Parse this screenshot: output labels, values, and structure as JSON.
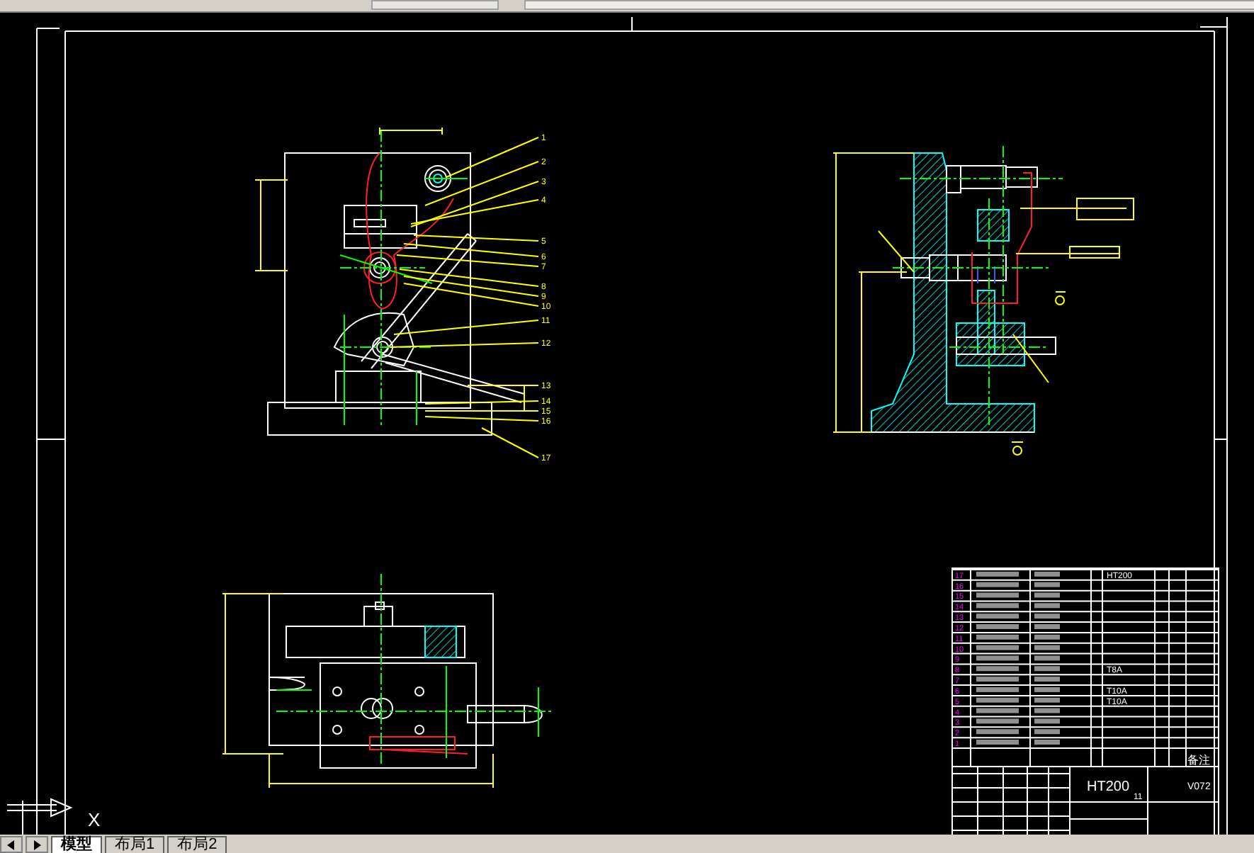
{
  "drawing": {
    "front_view_callouts": [
      "1",
      "2",
      "3",
      "4",
      "5",
      "6",
      "7",
      "8",
      "9",
      "10",
      "11",
      "12",
      "13",
      "14",
      "15",
      "16",
      "17"
    ],
    "parts_list": [
      {
        "number": "17",
        "material": "HT200"
      },
      {
        "number": "16"
      },
      {
        "number": "15"
      },
      {
        "number": "14"
      },
      {
        "number": "13"
      },
      {
        "number": "12"
      },
      {
        "number": "11"
      },
      {
        "number": "10"
      },
      {
        "number": "9"
      },
      {
        "number": "8",
        "material": "T8A"
      },
      {
        "number": "7"
      },
      {
        "number": "6",
        "material": "T10A"
      },
      {
        "number": "5",
        "material": "T10A"
      },
      {
        "number": "4"
      },
      {
        "number": "3"
      },
      {
        "number": "2"
      },
      {
        "number": "1"
      }
    ],
    "parts_list_header": {
      "remarks": "备注"
    },
    "title_block": {
      "material": "HT200",
      "drawing_no": "V072",
      "sheet": "11"
    }
  },
  "ucs_axis_label": "X",
  "layout_tabs": [
    {
      "label": "模型",
      "selected": true
    },
    {
      "label": "布局1",
      "selected": false
    },
    {
      "label": "布局2",
      "selected": false
    }
  ]
}
